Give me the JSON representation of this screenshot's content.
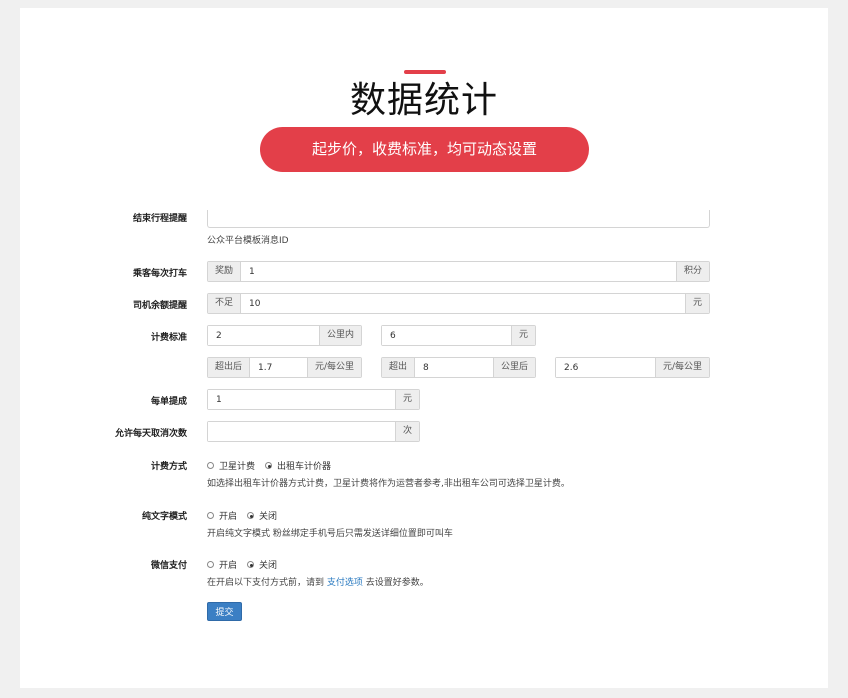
{
  "header": {
    "title": "数据统计",
    "subtitle": "起步价，收费标准，均可动态设置",
    "accent": "#e33f49"
  },
  "form": {
    "end_trip": {
      "label": "结束行程提醒",
      "help": "公众平台模板消息ID"
    },
    "rider_each": {
      "label": "乘客每次打车",
      "prefix": "奖励",
      "value": "1",
      "suffix": "积分"
    },
    "driver_balance": {
      "label": "司机余额提醒",
      "prefix": "不足",
      "value": "10",
      "suffix": "元"
    },
    "fare": {
      "label": "计费标准",
      "base_km": "2",
      "base_km_unit": "公里内",
      "base_price": "6",
      "base_price_unit": "元",
      "over1_prefix": "超出后",
      "over1_price": "1.7",
      "over1_unit": "元/每公里",
      "over2_prefix": "超出",
      "over2_km": "8",
      "over2_km_unit": "公里后",
      "over2_price": "2.6",
      "over2_unit": "元/每公里"
    },
    "per_order": {
      "label": "每单提成",
      "value": "1",
      "suffix": "元"
    },
    "daily_cancel": {
      "label": "允许每天取消次数",
      "value": "",
      "suffix": "次"
    },
    "billing_mode": {
      "label": "计费方式",
      "opt1": "卫星计费",
      "opt2": "出租车计价器",
      "help": "如选择出租车计价器方式计费，卫星计费将作为运营者参考,非出租车公司可选择卫星计费。"
    },
    "text_mode": {
      "label": "纯文字模式",
      "opt1": "开启",
      "opt2": "关闭",
      "help": "开启纯文字模式 粉丝绑定手机号后只需发送详细位置即可叫车"
    },
    "wechat_pay": {
      "label": "微信支付",
      "opt1": "开启",
      "opt2": "关闭",
      "help_before": "在开启以下支付方式前，请到",
      "help_link": "支付选项",
      "help_after": "去设置好参数。"
    },
    "submit": "提交"
  }
}
